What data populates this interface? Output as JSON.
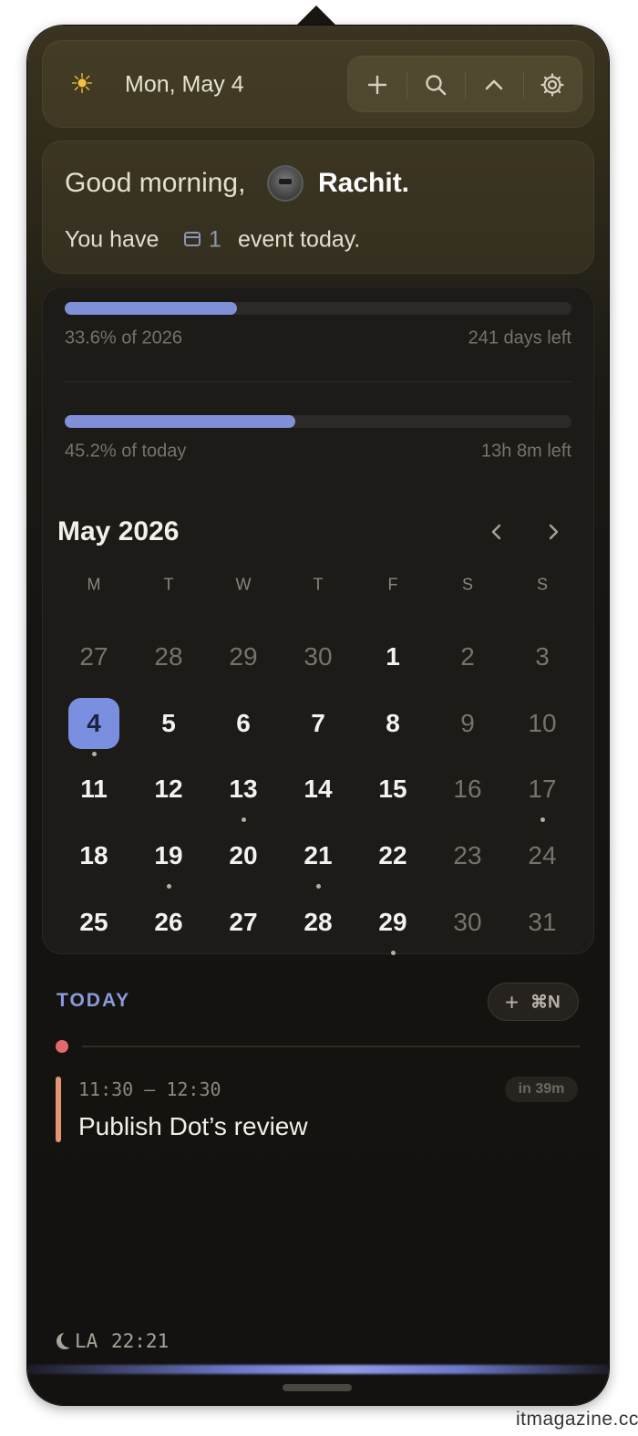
{
  "header": {
    "date": "Mon, May 4",
    "weather_icon": "sun-icon",
    "toolbar": [
      {
        "icon": "plus-icon",
        "glyph": "+"
      },
      {
        "icon": "search-icon"
      },
      {
        "icon": "chevron-up-icon"
      },
      {
        "icon": "gear-icon"
      }
    ]
  },
  "greeting": {
    "text": "Good morning,",
    "name": "Rachit.",
    "summary_lead": "You have",
    "event_count": "1",
    "summary_tail": "event today."
  },
  "progress": {
    "year": {
      "label": "33.6% of 2026",
      "remaining": "241 days left",
      "fraction": 0.336
    },
    "day": {
      "label": "45.2% of today",
      "remaining": "13h 8m left",
      "fraction": 0.452
    }
  },
  "calendar": {
    "month": "May 2026",
    "weekdays": [
      "M",
      "T",
      "W",
      "T",
      "F",
      "S",
      "S"
    ],
    "weeks": [
      [
        {
          "d": "27",
          "m": true
        },
        {
          "d": "28",
          "m": true
        },
        {
          "d": "29",
          "m": true
        },
        {
          "d": "30",
          "m": true
        },
        {
          "d": "1"
        },
        {
          "d": "2",
          "m": true
        },
        {
          "d": "3",
          "m": true
        }
      ],
      [
        {
          "d": "4",
          "today": true,
          "dot": true
        },
        {
          "d": "5"
        },
        {
          "d": "6"
        },
        {
          "d": "7"
        },
        {
          "d": "8"
        },
        {
          "d": "9",
          "m": true
        },
        {
          "d": "10",
          "m": true
        }
      ],
      [
        {
          "d": "11"
        },
        {
          "d": "12"
        },
        {
          "d": "13",
          "dot": true
        },
        {
          "d": "14"
        },
        {
          "d": "15"
        },
        {
          "d": "16",
          "m": true
        },
        {
          "d": "17",
          "m": true,
          "dot": true
        }
      ],
      [
        {
          "d": "18"
        },
        {
          "d": "19",
          "dot": true
        },
        {
          "d": "20"
        },
        {
          "d": "21",
          "dot": true
        },
        {
          "d": "22"
        },
        {
          "d": "23",
          "m": true
        },
        {
          "d": "24",
          "m": true
        }
      ],
      [
        {
          "d": "25"
        },
        {
          "d": "26"
        },
        {
          "d": "27"
        },
        {
          "d": "28"
        },
        {
          "d": "29",
          "dot": true
        },
        {
          "d": "30",
          "m": true
        },
        {
          "d": "31",
          "m": true
        }
      ]
    ]
  },
  "today": {
    "label": "TODAY",
    "quick_add": {
      "plus": "+",
      "shortcut": "⌘N"
    },
    "event": {
      "time": "11:30 – 12:30",
      "title": "Publish Dot’s review",
      "countdown": "in 39m"
    }
  },
  "footer": {
    "timezone": "LA",
    "time": "22:21"
  },
  "watermark": "itmagazine.cc",
  "colors": {
    "accent": "#7f90d8",
    "today_highlight": "#7b8fe0",
    "event_bar": "#e39577",
    "now_dot": "#e26a6a",
    "sun": "#f2c23a"
  }
}
